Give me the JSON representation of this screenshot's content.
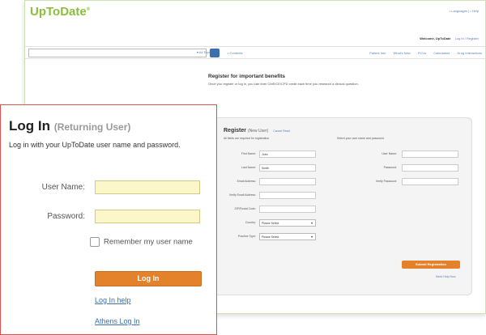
{
  "header": {
    "logo": "UpToDate",
    "logo_mark": "®",
    "top_links": "• Languages  |  • Help",
    "welcome": "Welcome, UpToDate",
    "welcome_link": "Log In / Register"
  },
  "toolbar": {
    "search_placeholder": "",
    "search_scope": "▾ All Topics",
    "contents": "• Contents",
    "nav": [
      "Patient Info",
      "What's New",
      "PCUs",
      "Calculators",
      "Drug Interactions"
    ]
  },
  "register": {
    "title": "Register for important benefits",
    "description": "Once you register or log in, you can earn CME/CE/CPD credit each time you research a clinical question.",
    "heading": "Register",
    "heading_sub": "(New User)",
    "heading_hint": "Cancel Reset",
    "left_desc": "All fields are required for registration",
    "right_desc": "Select your user name and password",
    "fields_left": [
      {
        "label": "First Name:",
        "value": "John"
      },
      {
        "label": "Last Name:",
        "value": "Smith"
      },
      {
        "label": "Email Address:",
        "value": ""
      },
      {
        "label": "Verify Email Address:",
        "value": ""
      },
      {
        "label": "ZIP/Postal Code:",
        "value": ""
      }
    ],
    "selects_left": [
      {
        "label": "Country:",
        "value": "Please Select"
      },
      {
        "label": "Practice Type:",
        "value": "Please Select"
      }
    ],
    "fields_right": [
      {
        "label": "User Name:",
        "value": ""
      },
      {
        "label": "Password:",
        "value": ""
      },
      {
        "label": "Verify Password:",
        "value": ""
      }
    ],
    "submit": "Submit Registration",
    "help": "Need Help Now"
  },
  "login": {
    "title": "Log In",
    "title_sub": "(Returning User)",
    "description": "Log in with your UpToDate user name and password.",
    "user_label": "User Name:",
    "password_label": "Password:",
    "remember": "Remember my user name",
    "button": "Log In",
    "help_link": "Log In help",
    "athens_link": "Athens Log In"
  }
}
